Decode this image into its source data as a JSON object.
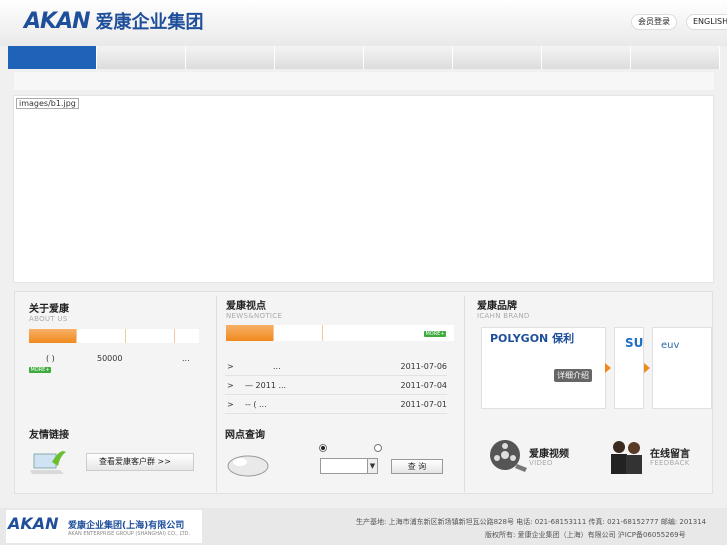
{
  "header": {
    "logo_mark": "AKAN",
    "logo_text": "爱康企业集团",
    "login_label": "会员登录",
    "english_label": "ENGLISH"
  },
  "banner": {
    "image_alt": "images/b1.jpg"
  },
  "about": {
    "title": "关于爱康",
    "subtitle": "ABOUT US",
    "row_left": "( )",
    "row_mid": "50000",
    "row_right": "...",
    "more": "MORE+"
  },
  "news": {
    "title": "爱康视点",
    "subtitle": "NEWS&NOTICE",
    "more": "MORE+",
    "items": [
      {
        "arrow": ">",
        "title": "...",
        "date": "2011-07-06"
      },
      {
        "arrow": ">",
        "title": "— 2011 ...",
        "date": "2011-07-04"
      },
      {
        "arrow": ">",
        "title": "-- ( ...",
        "date": "2011-07-01"
      }
    ]
  },
  "brand": {
    "title": "爱康品牌",
    "subtitle": "ICAHN BRAND",
    "polygon": "POLYGON 保利",
    "su": "SU",
    "euv": "euv",
    "detail": "详细介绍"
  },
  "friends": {
    "title": "友情链接",
    "button": "查看爱康客户群 >>"
  },
  "outlets": {
    "title": "网点查询",
    "search": "查 询"
  },
  "video": {
    "title": "爱康视频",
    "subtitle": "VIDEO"
  },
  "feedback": {
    "title": "在线留言",
    "subtitle": "FEEDBACK"
  },
  "footer": {
    "mark": "AKAN",
    "company": "爱康企业集团(上海)有限公司",
    "company_en": "AKAN ENTERPRISE GROUP (SHANGHAI) CO., LTD.",
    "line1": "生产基地: 上海市浦东新区新场镇新坦瓦公路828号    电话: 021-68153111    传真: 021-68152777    邮编: 201314",
    "line2": "版权所有: 爱康企业集团（上海）有限公司    沪ICP备06055269号"
  }
}
